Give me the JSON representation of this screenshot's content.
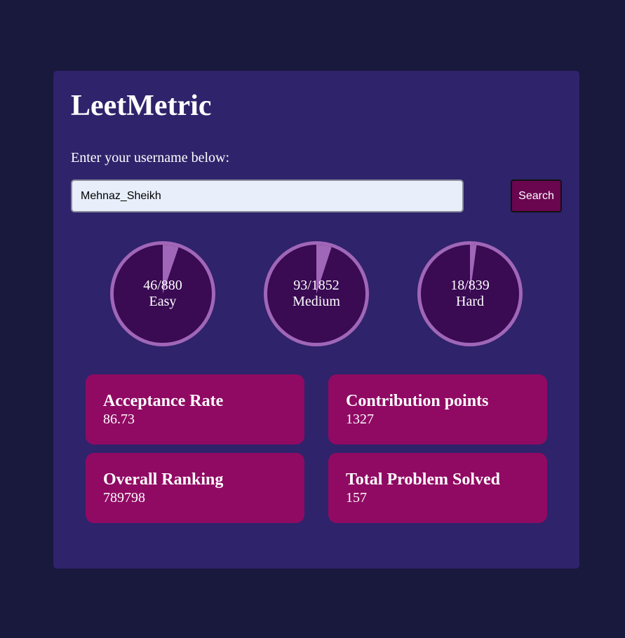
{
  "app": {
    "title": "LeetMetric",
    "prompt": "Enter your username below:"
  },
  "search": {
    "value": "Mehnaz_Sheikh",
    "button_label": "Search"
  },
  "progress": [
    {
      "label": "Easy",
      "text": "46/880",
      "solved": 46,
      "total": 880
    },
    {
      "label": "Medium",
      "text": "93/1852",
      "solved": 93,
      "total": 1852
    },
    {
      "label": "Hard",
      "text": "18/839",
      "solved": 18,
      "total": 839
    }
  ],
  "stats": [
    {
      "title": "Acceptance Rate",
      "value": "86.73"
    },
    {
      "title": "Contribution points",
      "value": "1327"
    },
    {
      "title": "Overall Ranking",
      "value": "789798"
    },
    {
      "title": "Total Problem Solved",
      "value": "157"
    }
  ],
  "colors": {
    "background": "#19183d",
    "panel": "#2f236b",
    "circle_fill": "#3a0a53",
    "circle_progress": "#a066b7",
    "card": "#900a63",
    "button": "#6a0550"
  }
}
